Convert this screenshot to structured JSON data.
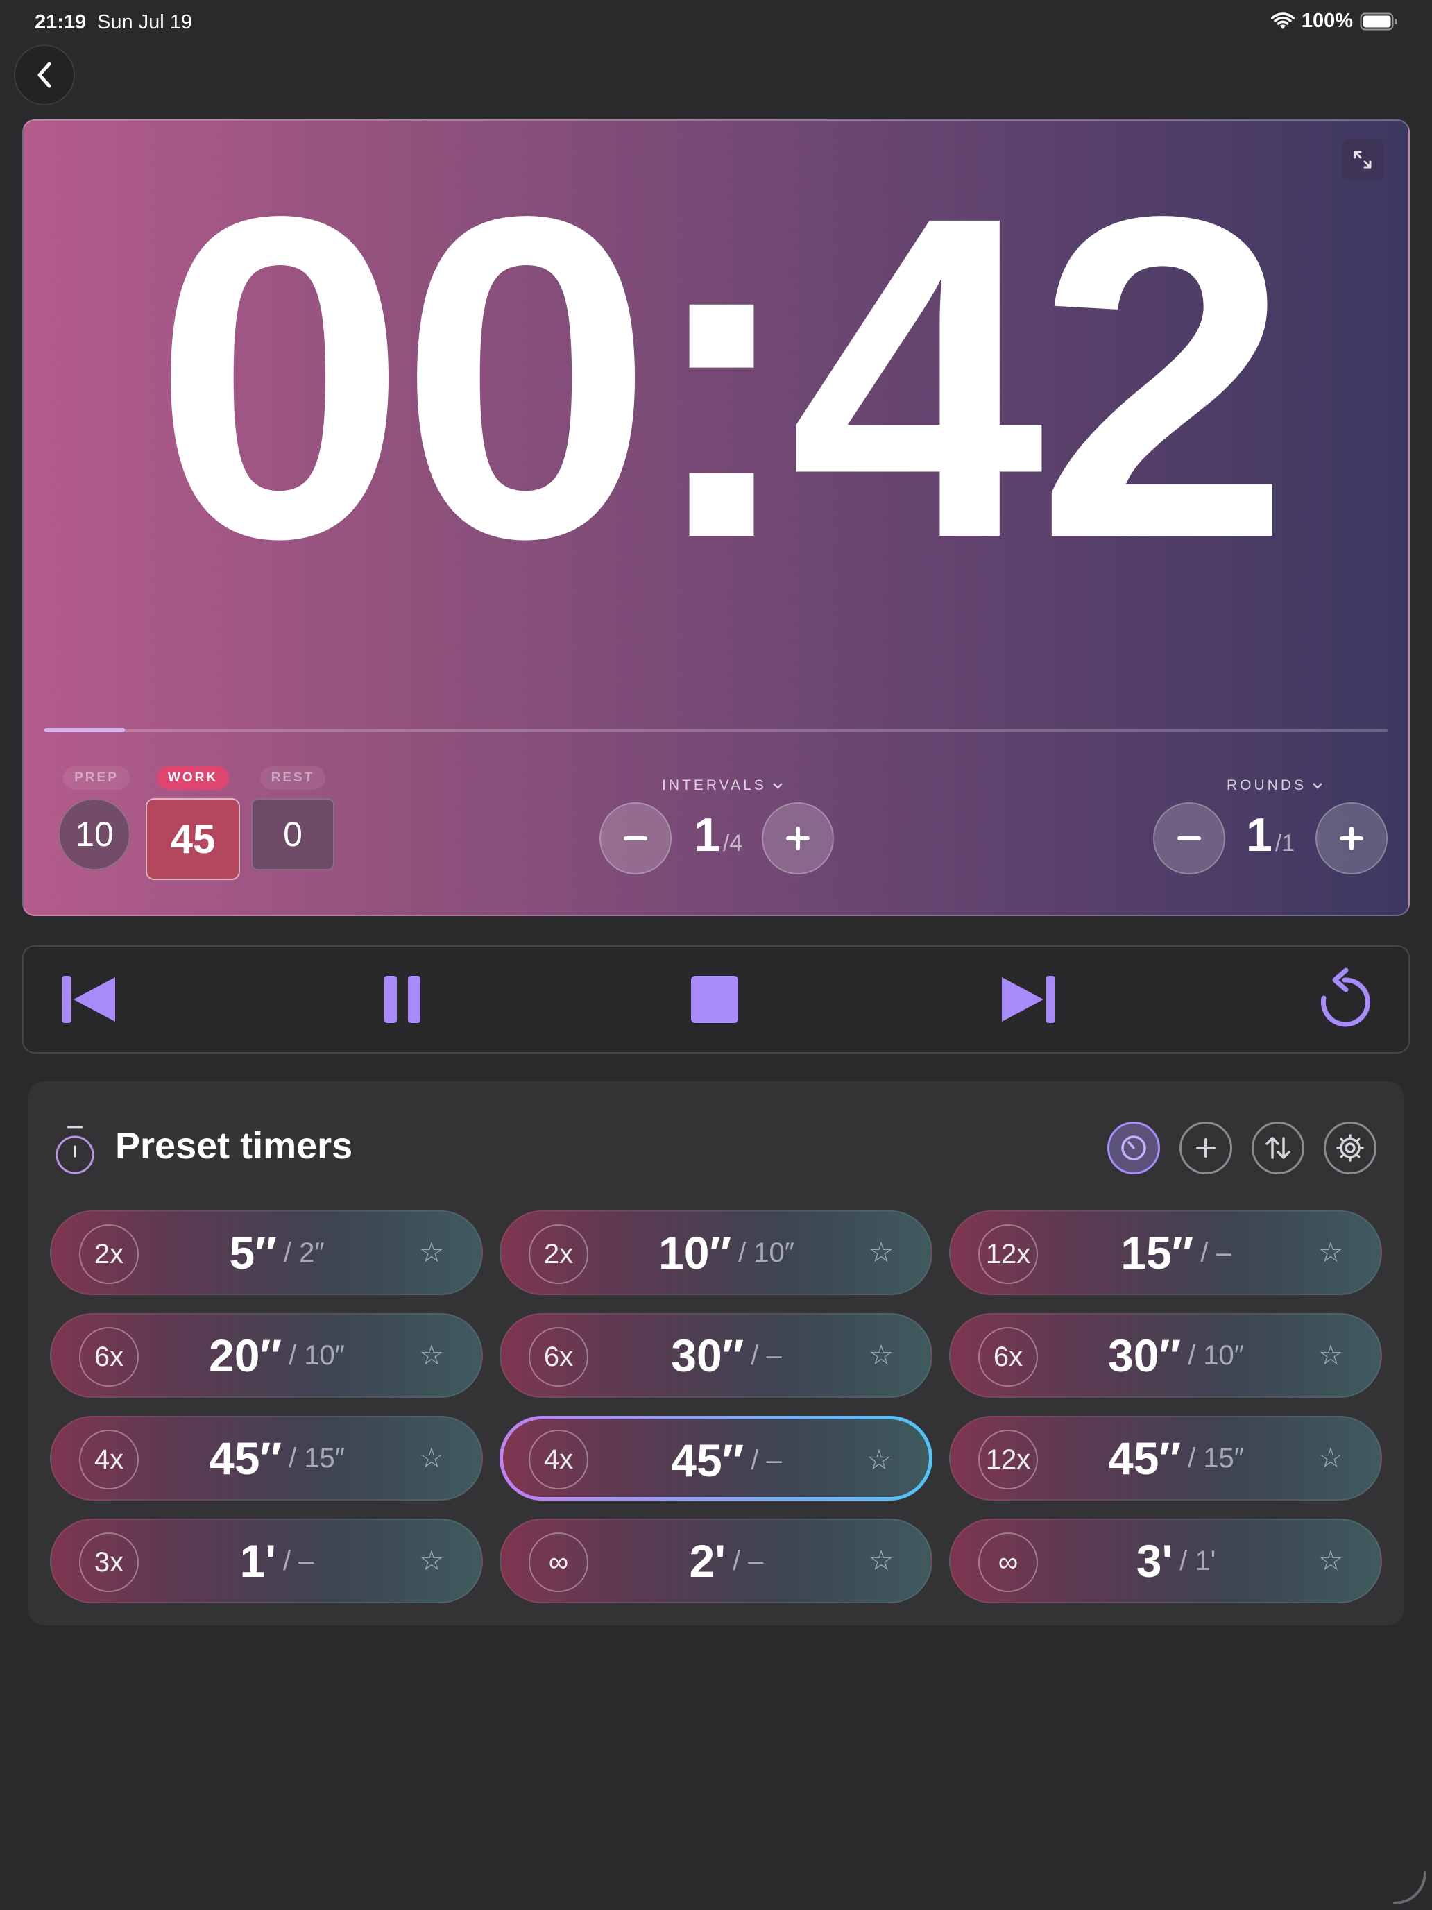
{
  "status": {
    "time": "21:19",
    "date": "Sun Jul 19",
    "battery": "100%"
  },
  "timer": {
    "display": "00:42",
    "progress": 0.06,
    "phases": [
      {
        "label": "PREP",
        "value": "10",
        "active": false
      },
      {
        "label": "WORK",
        "value": "45",
        "active": true
      },
      {
        "label": "REST",
        "value": "0",
        "active": false
      }
    ],
    "intervals": {
      "label": "INTERVALS",
      "current": "1",
      "total": "/4"
    },
    "rounds": {
      "label": "ROUNDS",
      "current": "1",
      "total": "/1"
    }
  },
  "presets": {
    "title": "Preset timers",
    "items": [
      {
        "count": "2x",
        "work": "5″",
        "rest": "/ 2″"
      },
      {
        "count": "2x",
        "work": "10″",
        "rest": "/ 10″"
      },
      {
        "count": "12x",
        "work": "15″",
        "rest": "/ –"
      },
      {
        "count": "6x",
        "work": "20″",
        "rest": "/ 10″"
      },
      {
        "count": "6x",
        "work": "30″",
        "rest": "/ –"
      },
      {
        "count": "6x",
        "work": "30″",
        "rest": "/ 10″"
      },
      {
        "count": "4x",
        "work": "45″",
        "rest": "/ 15″"
      },
      {
        "count": "4x",
        "work": "45″",
        "rest": "/ –",
        "selected": true
      },
      {
        "count": "12x",
        "work": "45″",
        "rest": "/ 15″"
      },
      {
        "count": "3x",
        "work": "1'",
        "rest": "/ –"
      },
      {
        "count": "∞",
        "work": "2'",
        "rest": "/ –"
      },
      {
        "count": "∞",
        "work": "3'",
        "rest": "/ 1'"
      }
    ]
  },
  "icons": {
    "accent": "#a78bfa",
    "star": "☆"
  }
}
